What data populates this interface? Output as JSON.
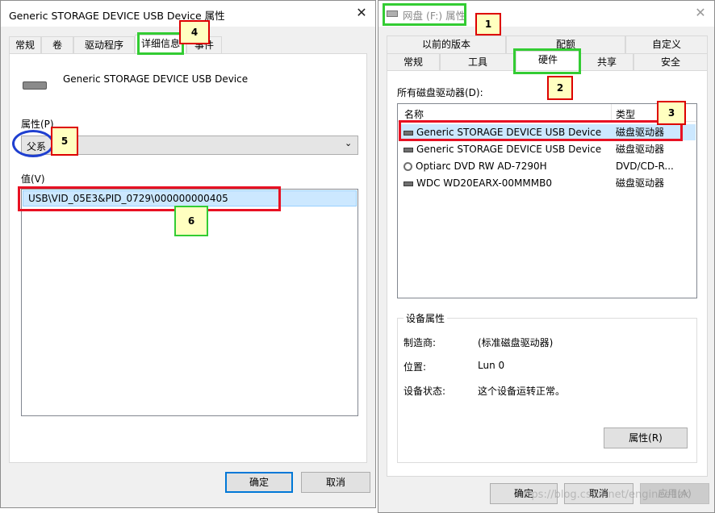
{
  "left_window": {
    "title": "Generic STORAGE DEVICE USB Device 属性",
    "close": "✕",
    "tabs": [
      "常规",
      "卷",
      "驱动程序",
      "详细信息",
      "事件"
    ],
    "device_name": "Generic STORAGE DEVICE USB Device",
    "property_label": "属性(P)",
    "property_selected": "父系",
    "value_label": "值(V)",
    "value_item": "USB\\VID_05E3&PID_0729\\000000000405",
    "ok": "确定",
    "cancel": "取消"
  },
  "right_window": {
    "title": "网盘 (F:) 属性",
    "close": "✕",
    "tabs_top": [
      "以前的版本",
      "配额",
      "自定义"
    ],
    "tabs_bottom": [
      "常规",
      "工具",
      "硬件",
      "共享",
      "安全"
    ],
    "drives_label": "所有磁盘驱动器(D):",
    "col_name": "名称",
    "col_type": "类型",
    "drives": [
      {
        "name": "Generic STORAGE DEVICE USB Device",
        "type": "磁盘驱动器",
        "icon": "drive-icon"
      },
      {
        "name": "Generic STORAGE DEVICE USB Device",
        "type": "磁盘驱动器",
        "icon": "drive-icon"
      },
      {
        "name": "Optiarc DVD RW AD-7290H",
        "type": "DVD/CD-R...",
        "icon": "disc-icon"
      },
      {
        "name": "WDC WD20EARX-00MMMB0",
        "type": "磁盘驱动器",
        "icon": "drive-icon"
      }
    ],
    "group_title": "设备属性",
    "props": [
      {
        "label": "制造商:",
        "value": "(标准磁盘驱动器)"
      },
      {
        "label": "位置:",
        "value": "Lun 0"
      },
      {
        "label": "设备状态:",
        "value": "这个设备运转正常。"
      }
    ],
    "properties_btn": "属性(R)",
    "ok": "确定",
    "cancel": "取消",
    "apply": "应用(A)"
  },
  "annotations": [
    "1",
    "2",
    "3",
    "4",
    "5",
    "6"
  ],
  "watermark": "https://blog.csdn.net/enginee1zk"
}
